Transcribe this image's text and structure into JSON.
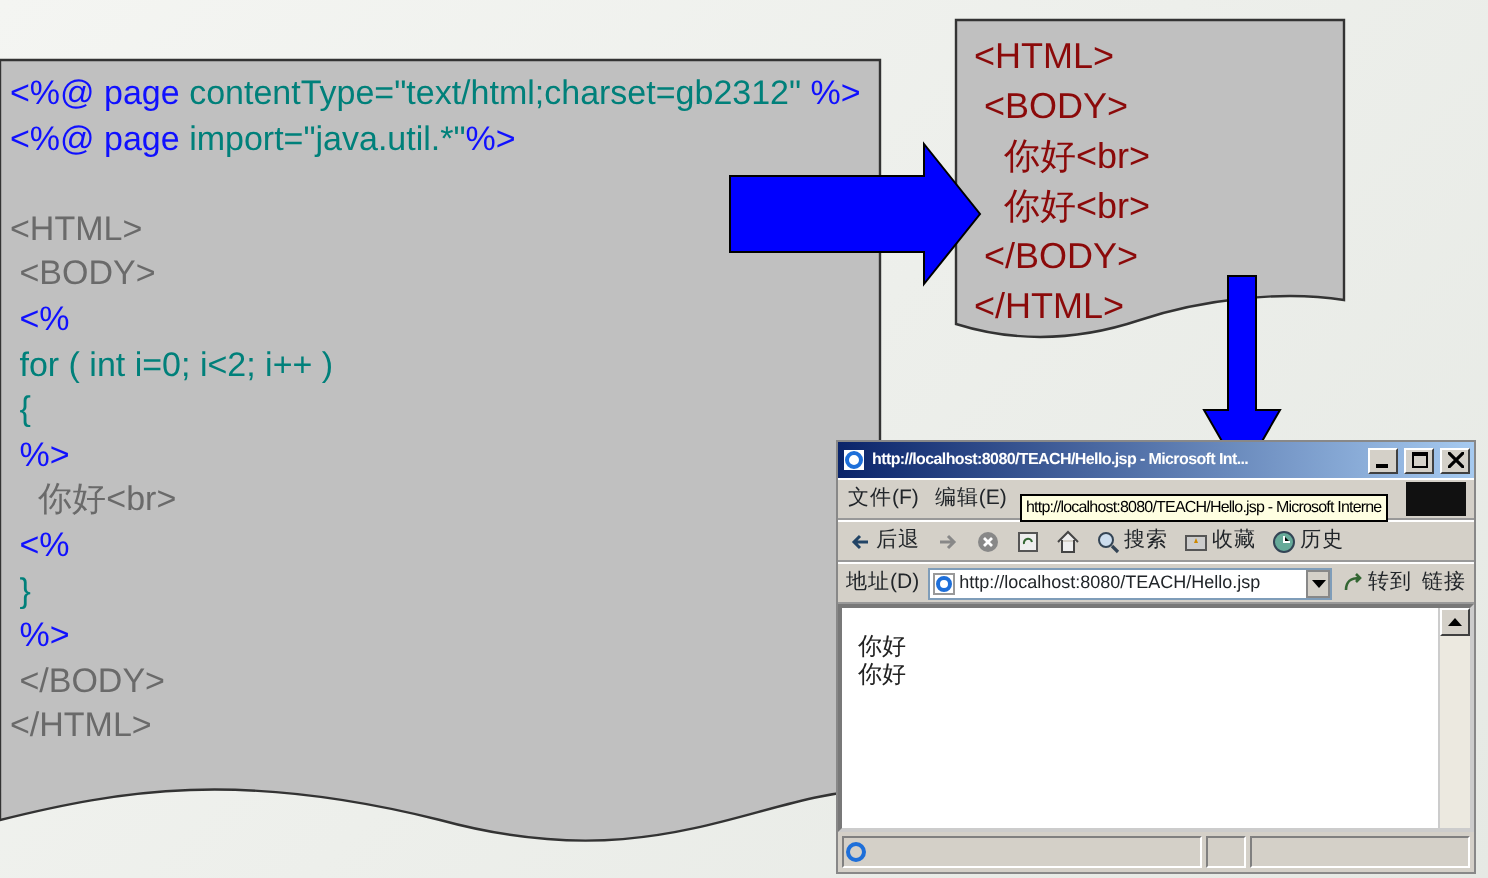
{
  "source_code": {
    "lines": [
      {
        "segments": [
          {
            "kind": "directive",
            "text": "<%@ page"
          },
          {
            "kind": "code",
            "text": " contentType=\"text/html;charset=gb2312\""
          },
          {
            "kind": "directive",
            "text": " %>"
          }
        ]
      },
      {
        "segments": [
          {
            "kind": "directive",
            "text": "<%@ page"
          },
          {
            "kind": "code",
            "text": " import=\"java.util.*\""
          },
          {
            "kind": "directive",
            "text": "%>"
          }
        ],
        "gap_after": true
      },
      {
        "segments": [
          {
            "kind": "markup",
            "text": "<HTML>"
          }
        ]
      },
      {
        "segments": [
          {
            "kind": "markup",
            "text": " <BODY>"
          }
        ]
      },
      {
        "segments": [
          {
            "kind": "directive",
            "text": " <%"
          }
        ]
      },
      {
        "segments": [
          {
            "kind": "code",
            "text": " for ( int i=0; i<2; i++ )"
          }
        ]
      },
      {
        "segments": [
          {
            "kind": "code",
            "text": " {"
          }
        ]
      },
      {
        "segments": [
          {
            "kind": "directive",
            "text": " %>"
          }
        ]
      },
      {
        "segments": [
          {
            "kind": "markup",
            "text": "   你好<br>"
          }
        ]
      },
      {
        "segments": [
          {
            "kind": "directive",
            "text": " <%"
          }
        ]
      },
      {
        "segments": [
          {
            "kind": "code",
            "text": " }"
          }
        ]
      },
      {
        "segments": [
          {
            "kind": "directive",
            "text": " %>"
          }
        ]
      },
      {
        "segments": [
          {
            "kind": "markup",
            "text": " </BODY>"
          }
        ]
      },
      {
        "segments": [
          {
            "kind": "markup",
            "text": "</HTML>"
          }
        ]
      }
    ]
  },
  "generated_html": {
    "lines": [
      "<HTML>",
      " <BODY>",
      "   你好<br>",
      "   你好<br>",
      " </BODY>",
      "</HTML>"
    ]
  },
  "browser": {
    "title": "http://localhost:8080/TEACH/Hello.jsp - Microsoft Int...",
    "menu": [
      "文件(F)",
      "编辑(E)"
    ],
    "tooltip": "http://localhost:8080/TEACH/Hello.jsp - Microsoft Interne",
    "toolbar": [
      {
        "kind": "back",
        "label": "后退"
      },
      {
        "kind": "forward"
      },
      {
        "kind": "stop"
      },
      {
        "kind": "refresh"
      },
      {
        "kind": "home"
      },
      {
        "kind": "search",
        "label": "搜索"
      },
      {
        "kind": "favorites",
        "label": "收藏"
      },
      {
        "kind": "history",
        "label": "历史"
      }
    ],
    "address_label": "地址(D)",
    "url": "http://localhost:8080/TEACH/Hello.jsp",
    "go": "转到",
    "links": "链接",
    "content": [
      "你好",
      "你好"
    ]
  }
}
